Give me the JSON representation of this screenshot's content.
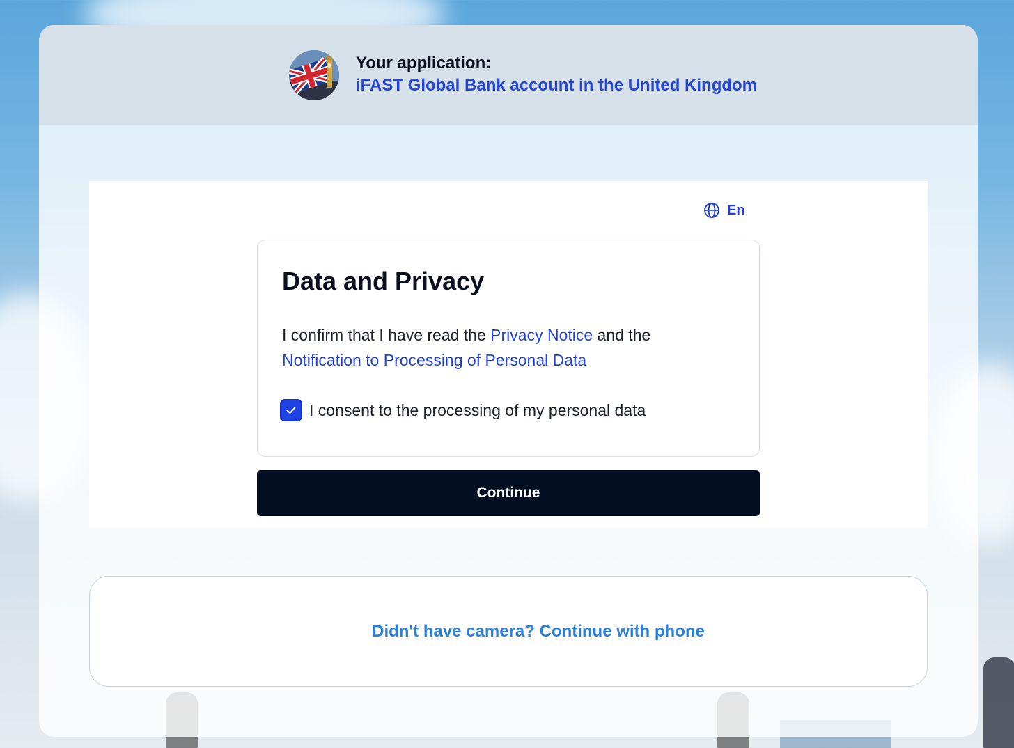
{
  "header": {
    "label": "Your application:",
    "application_name": "iFAST Global Bank account in the United Kingdom",
    "thumbnail_icon": "uk-flag-big-ben-icon"
  },
  "language": {
    "icon": "globe-icon",
    "label": "En"
  },
  "privacy_card": {
    "title": "Data and Privacy",
    "confirm_prefix": "I confirm that I have read the",
    "privacy_notice_link": "Privacy Notice",
    "confirm_middle": "and the",
    "notification_link": "Notification to Processing of Personal Data",
    "consent_label": "I consent to the processing of my personal data",
    "consent_checked": true
  },
  "continue_button": {
    "label": "Continue"
  },
  "phone_option": {
    "label": "Didn't have camera? Continue with phone"
  },
  "colors": {
    "accent": "#1f42e4",
    "link": "#2343e0",
    "button_bg": "#020e22",
    "phone_link": "#2a7fd9",
    "header_bg": "#d6e0e8"
  }
}
